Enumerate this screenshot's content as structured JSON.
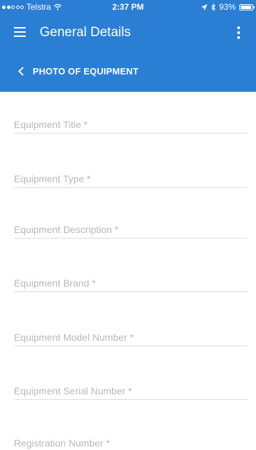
{
  "status_bar": {
    "carrier": "Telstra",
    "time": "2:37 PM",
    "battery": "93%",
    "battery_level": 0.93,
    "signal_bars_filled": 2,
    "signal_bars_total": 5
  },
  "app_bar": {
    "title": "General Details",
    "back_label": "PHOTO OF EQUIPMENT",
    "background_color": "#2a7fd4"
  },
  "form": {
    "fields": [
      {
        "placeholder": "Equipment Title *",
        "value": ""
      },
      {
        "placeholder": "Equipment Type *",
        "value": ""
      },
      {
        "placeholder": "Equipment Description *",
        "value": ""
      },
      {
        "placeholder": "Equipment Brand *",
        "value": ""
      },
      {
        "placeholder": "Equipment Model Number *",
        "value": ""
      },
      {
        "placeholder": "Equipment Serial Number *",
        "value": ""
      },
      {
        "placeholder": "Registration Number *",
        "value": ""
      }
    ]
  }
}
